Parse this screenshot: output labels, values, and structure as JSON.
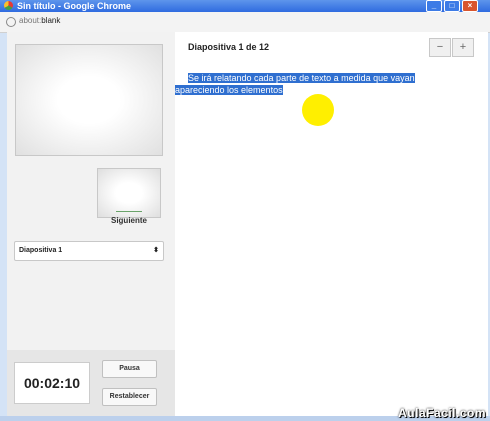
{
  "window": {
    "title": "Sin título - Google Chrome",
    "address_scheme": "about:",
    "address_rest": "blank"
  },
  "sidebar": {
    "next_label": "Siguiente",
    "slide_select_value": "Diapositiva 1",
    "timer": "00:02:10",
    "pause_label": "Pausa",
    "reset_label": "Restablecer"
  },
  "main": {
    "slide_header": "Diapositiva 1 de 12",
    "zoom_out": "−",
    "zoom_in": "+",
    "notes_line1": "Se irá relatando cada parte de texto a medida que vayan",
    "notes_line2": "apareciendo los elementos"
  },
  "watermark": "AulaFacil.com",
  "colors": {
    "selection": "#2f6fd0",
    "cursor_highlight": "#ffef00",
    "titlebar": "#2f6be0"
  }
}
